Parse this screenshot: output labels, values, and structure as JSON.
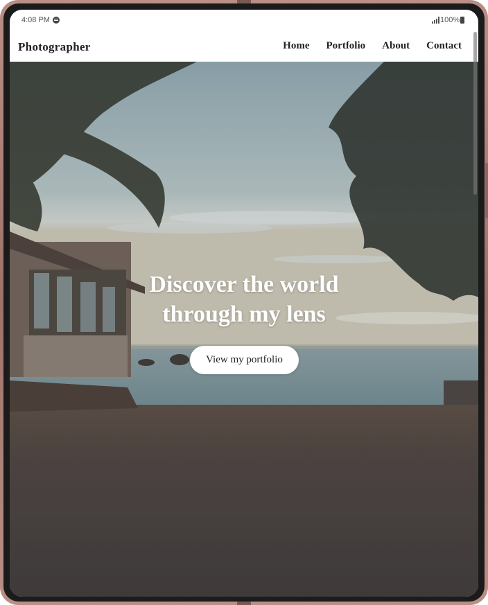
{
  "status_bar": {
    "time": "4:08 PM",
    "battery": "100%",
    "app_icon": "spotify-icon",
    "signal_icon": "signal-icon",
    "battery_icon": "battery-icon"
  },
  "navbar": {
    "brand": "Photographer",
    "links": [
      "Home",
      "Portfolio",
      "About",
      "Contact"
    ]
  },
  "hero": {
    "title_line1": "Discover the world",
    "title_line2": "through my lens",
    "cta_label": "View my portfolio",
    "image_icon": "beach-photo"
  },
  "colors": {
    "frame": "#b98f86",
    "text_dark": "#222222",
    "hero_text": "#ffffff"
  }
}
